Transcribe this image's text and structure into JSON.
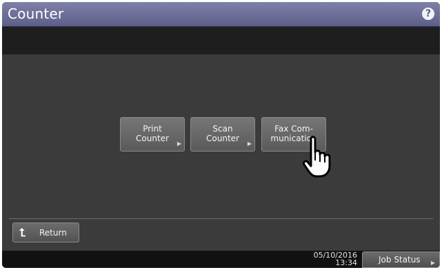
{
  "window": {
    "title": "Counter"
  },
  "icons": {
    "help": "help-icon",
    "return": "return-arrow-icon",
    "cursor": "hand-pointer-icon"
  },
  "colors": {
    "titlebar": "#6e7099",
    "background": "#3b3b3b",
    "button": "#676767"
  },
  "buttons": [
    {
      "label": "Print\nCounter"
    },
    {
      "label": "Scan\nCounter"
    },
    {
      "label": "Fax Com-\nmunication"
    }
  ],
  "footer": {
    "return_label": "Return",
    "date": "05/10/2016",
    "time": "13:34",
    "job_status_label": "Job Status"
  },
  "help_glyph": "?"
}
